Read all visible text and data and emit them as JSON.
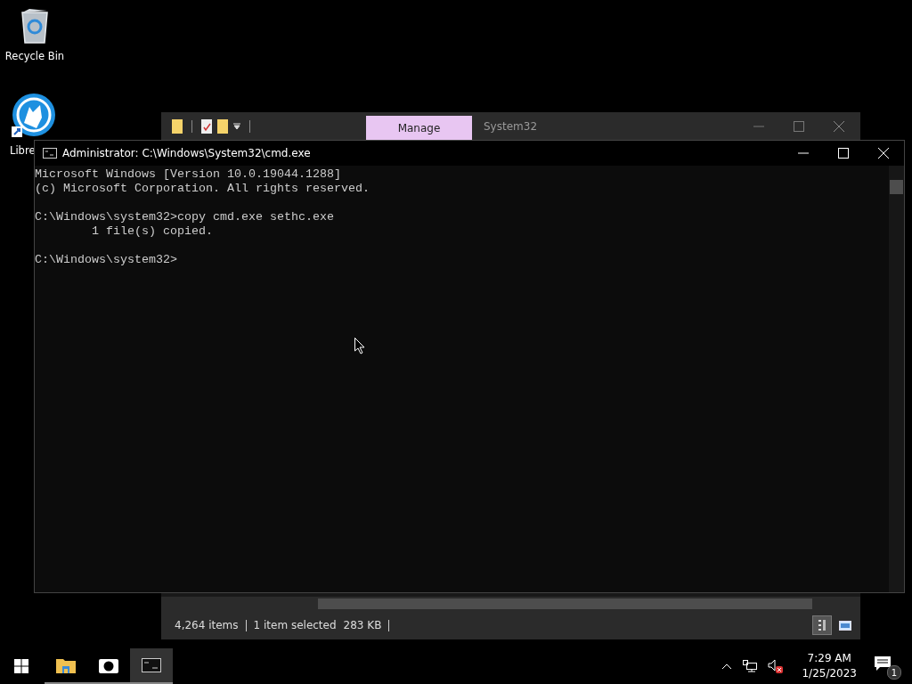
{
  "desktop_icons": [
    {
      "kind": "recycle",
      "label": "Recycle Bin"
    },
    {
      "kind": "wolf",
      "label": "Libre"
    }
  ],
  "explorer": {
    "context_tab": {
      "label": "Manage",
      "selected": true
    },
    "title": "System32",
    "status": {
      "items": "4,264 items",
      "selection": "1 item selected",
      "size": "283 KB"
    },
    "views": [
      {
        "kind": "details",
        "selected": true
      },
      {
        "kind": "tiles",
        "selected": false
      }
    ]
  },
  "cmd": {
    "title": "Administrator: C:\\Windows\\System32\\cmd.exe",
    "blocks": [
      [
        "Microsoft Windows [Version 10.0.19044.1288]",
        "(c) Microsoft Corporation. All rights reserved."
      ],
      [
        "C:\\Windows\\system32>copy cmd.exe sethc.exe",
        "        1 file(s) copied."
      ],
      [
        "C:\\Windows\\system32>"
      ]
    ]
  },
  "taskbar": {
    "apps": [
      {
        "kind": "folder",
        "running": true,
        "selected": false
      },
      {
        "kind": "camera",
        "running": true,
        "selected": false
      },
      {
        "kind": "console",
        "running": true,
        "selected": true
      }
    ],
    "time": "7:29 AM",
    "date": "1/25/2023",
    "notifications": "1"
  }
}
